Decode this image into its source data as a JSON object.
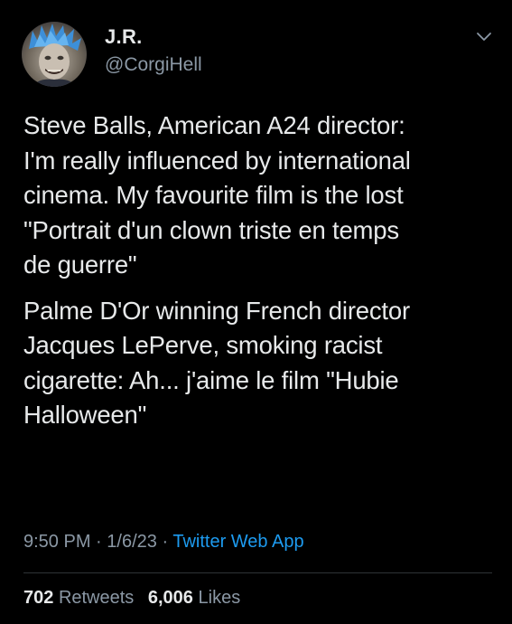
{
  "user": {
    "display_name": "J.R.",
    "handle": "@CorgiHell",
    "avatar_icon": "avatar-photo"
  },
  "tweet": {
    "paragraphs": [
      "Steve Balls, American A24 director:\nI'm really influenced by international\ncinema. My favourite film is the lost\n\"Portrait d'un clown triste en temps\nde guerre\"",
      "Palme D'Or winning French director\nJacques LePerve, smoking racist\ncigarette: Ah... j'aime le film \"Hubie\nHalloween\""
    ],
    "time": "9:50 PM",
    "date": "1/6/23",
    "separator": "·",
    "source": "Twitter Web App"
  },
  "stats": {
    "retweets_count": "702",
    "retweets_label": "Retweets",
    "likes_count": "6,006",
    "likes_label": "Likes"
  },
  "colors": {
    "background": "#000000",
    "text": "#e7e9ea",
    "secondary": "#8b98a5",
    "link": "#1d9bf0",
    "divider": "#2f3336"
  },
  "icons": {
    "more": "chevron-down-icon"
  }
}
